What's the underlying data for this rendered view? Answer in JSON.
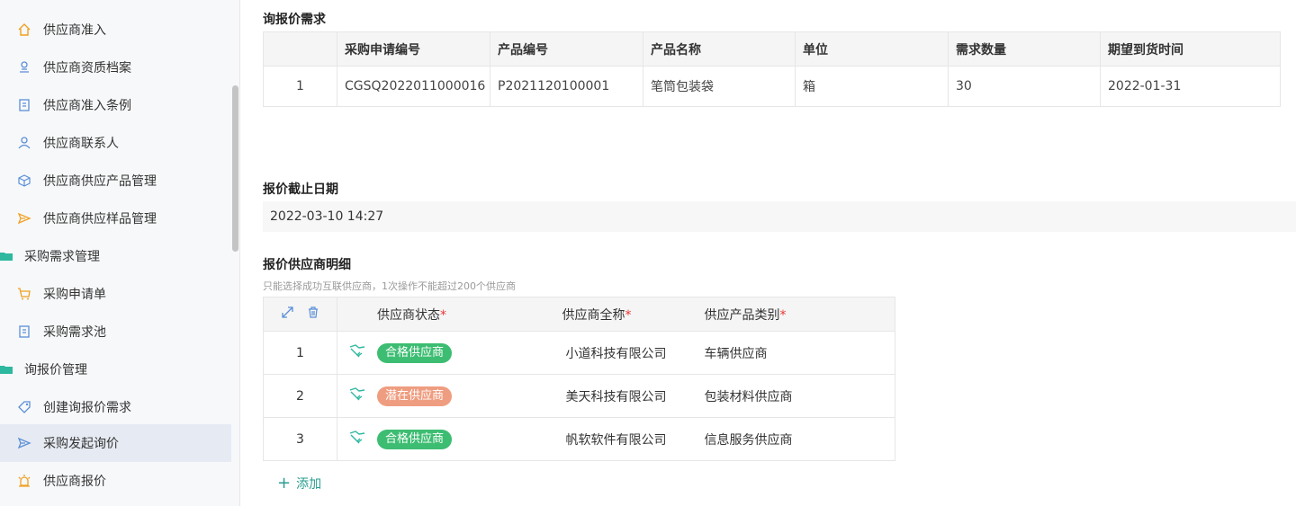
{
  "sidebar": {
    "items": [
      {
        "label": "供应商准入",
        "icon": "home-icon"
      },
      {
        "label": "供应商资质档案",
        "icon": "stamp-icon"
      },
      {
        "label": "供应商准入条例",
        "icon": "document-icon"
      },
      {
        "label": "供应商联系人",
        "icon": "user-icon"
      },
      {
        "label": "供应商供应产品管理",
        "icon": "box-icon"
      },
      {
        "label": "供应商供应样品管理",
        "icon": "send-icon"
      },
      {
        "label": "采购需求管理",
        "icon": "folder-icon"
      },
      {
        "label": "采购申请单",
        "icon": "cart-icon"
      },
      {
        "label": "采购需求池",
        "icon": "document-icon"
      },
      {
        "label": "询报价管理",
        "icon": "folder-icon"
      },
      {
        "label": "创建询报价需求",
        "icon": "tag-icon"
      },
      {
        "label": "采购发起询价",
        "icon": "send-icon"
      },
      {
        "label": "供应商报价",
        "icon": "alarm-icon"
      }
    ]
  },
  "inquiry": {
    "title": "询报价需求",
    "headers": [
      "",
      "采购申请编号",
      "产品编号",
      "产品名称",
      "单位",
      "需求数量",
      "期望到货时间"
    ],
    "rows": [
      [
        "1",
        "CGSQ2022011000016",
        "P2021120100001",
        "笔筒包装袋",
        "箱",
        "30",
        "2022-01-31"
      ]
    ]
  },
  "deadline": {
    "title": "报价截止日期",
    "value": "2022-03-10 14:27"
  },
  "suppliers": {
    "title": "报价供应商明细",
    "hint": "只能选择成功互联供应商，1次操作不能超过200个供应商",
    "headers": {
      "status": "供应商状态",
      "name": "供应商全称",
      "category": "供应产品类别",
      "required_mark": "*"
    },
    "rows": [
      {
        "index": "1",
        "status": "合格供应商",
        "status_color": "#3dbd72",
        "name": "小道科技有限公司",
        "category": "车辆供应商"
      },
      {
        "index": "2",
        "status": "潜在供应商",
        "status_color": "#ef9d80",
        "name": "美天科技有限公司",
        "category": "包装材料供应商"
      },
      {
        "index": "3",
        "status": "合格供应商",
        "status_color": "#3dbd72",
        "name": "帆软软件有限公司",
        "category": "信息服务供应商"
      }
    ],
    "add_label": "添加"
  },
  "colors": {
    "accent": "#2a9d8f",
    "icon_blue": "#5b8fd6",
    "icon_orange": "#f0a020"
  }
}
